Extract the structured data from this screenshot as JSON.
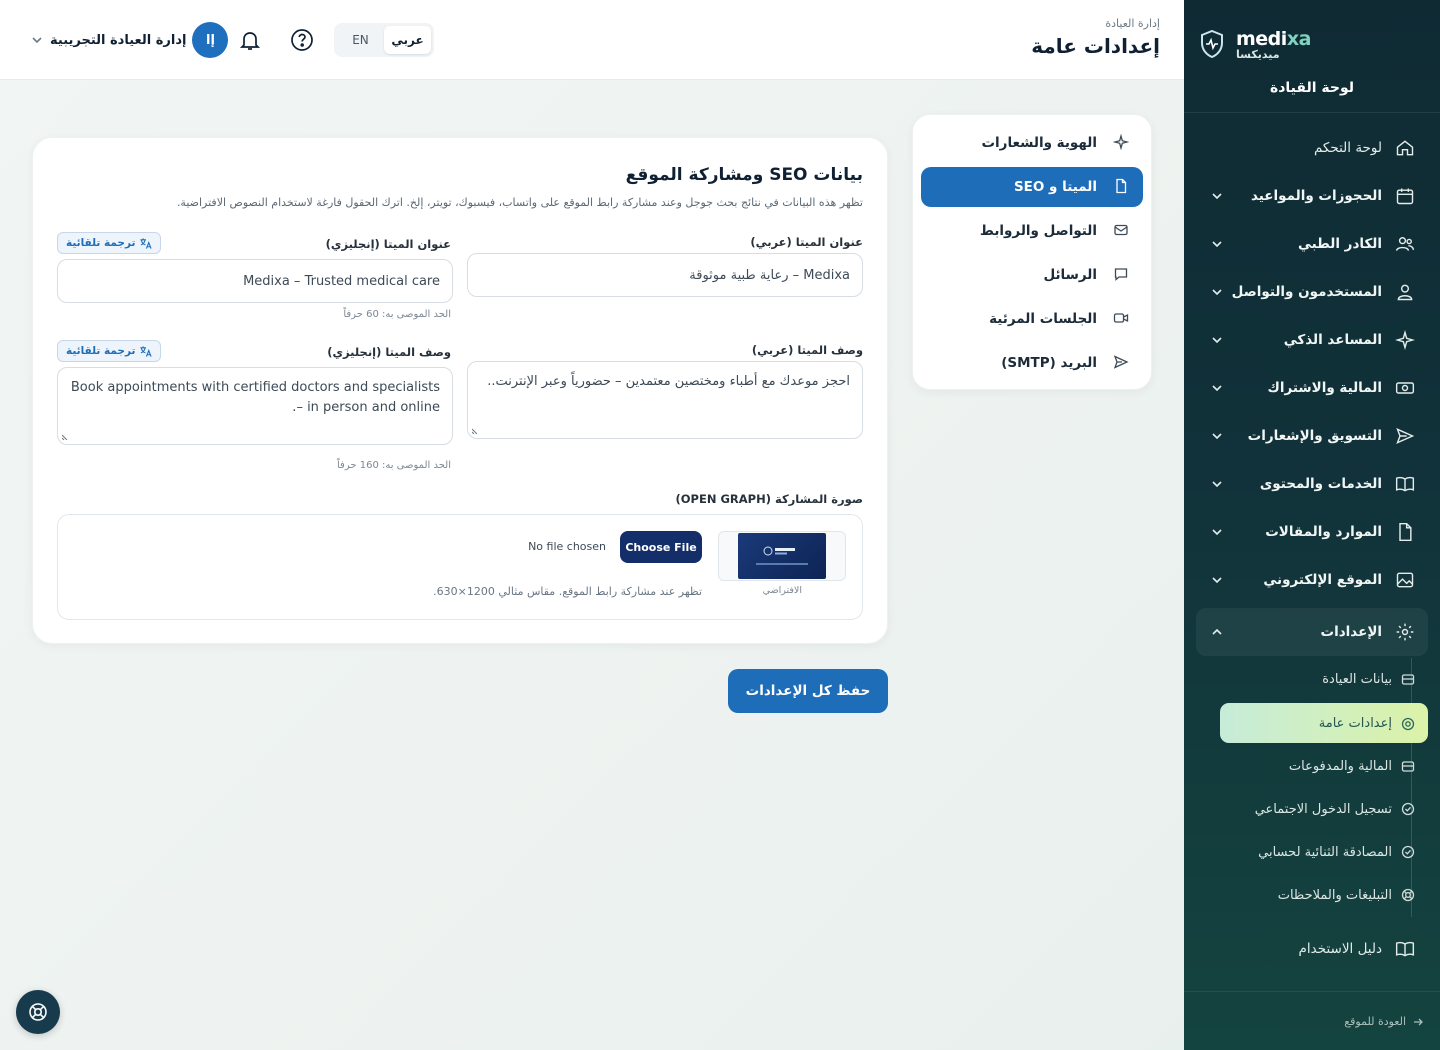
{
  "brand": {
    "name_a": "medi",
    "name_b": "xa",
    "name_ar": "ميديكسا",
    "dashboard_title": "لوحة القيادة"
  },
  "sidebar": {
    "items": [
      {
        "label": "لوحة التحكم",
        "icon": "home-icon"
      },
      {
        "label": "الحجوزات والمواعيد",
        "icon": "calendar-icon"
      },
      {
        "label": "الكادر الطبي",
        "icon": "users-icon"
      },
      {
        "label": "المستخدمون والتواصل",
        "icon": "user-icon"
      },
      {
        "label": "المساعد الذكي",
        "icon": "sparkles-icon"
      },
      {
        "label": "المالية والاشتراك",
        "icon": "money-icon"
      },
      {
        "label": "التسويق والإشعارات",
        "icon": "send-icon"
      },
      {
        "label": "الخدمات والمحتوى",
        "icon": "book-icon"
      },
      {
        "label": "الموارد والمقالات",
        "icon": "file-icon"
      },
      {
        "label": "الموقع الإلكتروني",
        "icon": "image-icon"
      }
    ],
    "settings_label": "الإعدادات",
    "sub_items": [
      {
        "label": "بيانات العيادة"
      },
      {
        "label": "إعدادات عامة"
      },
      {
        "label": "المالية والمدفوعات"
      },
      {
        "label": "تسجيل الدخول الاجتماعي"
      },
      {
        "label": "المصادقة الثنائية لحسابي"
      },
      {
        "label": "التبليغات والملاحظات"
      }
    ],
    "guide_label": "دليل الاستخدام",
    "back_label": "العودة للموقع"
  },
  "header": {
    "breadcrumb": "إدارة العيادة",
    "title": "إعدادات عامة",
    "lang_ar": "عربي",
    "lang_en": "EN",
    "user_name": "إدارة العيادة التجريبية",
    "user_initials": "إا"
  },
  "submenu": {
    "items": [
      {
        "label": "الهوية والشعارات"
      },
      {
        "label": "الميتا و SEO"
      },
      {
        "label": "التواصل والروابط"
      },
      {
        "label": "الرسائل"
      },
      {
        "label": "الجلسات المرئية"
      },
      {
        "label": "البريد (SMTP)"
      }
    ]
  },
  "seo": {
    "title": "بيانات SEO ومشاركة الموقع",
    "description": "تظهر هذه البيانات في نتائج بحث جوجل وعند مشاركة رابط الموقع على واتساب، فيسبوك، تويتر، إلخ. اترك الحقول فارغة لاستخدام النصوص الافتراضية.",
    "meta_title_ar_label": "عنوان الميتا (عربي)",
    "meta_title_ar_value": "Medixa – رعاية طبية موثوقة",
    "meta_title_en_label": "عنوان الميتا (إنجليزي)",
    "meta_title_en_value": "Medixa – Trusted medical care",
    "meta_title_hint": "الحد الموصى به: 60 حرفاً",
    "meta_desc_ar_label": "وصف الميتا (عربي)",
    "meta_desc_ar_value": "احجز موعدك مع أطباء ومختصين معتمدين – حضورياً وعبر الإنترنت..",
    "meta_desc_en_label": "وصف الميتا (إنجليزي)",
    "meta_desc_en_value": "Book appointments with certified doctors and specialists – in person and online.",
    "meta_desc_hint": "الحد الموصى به: 160 حرفاً",
    "auto_translate": "ترجمة تلقائية",
    "og_label": "صورة المشاركة (OPEN GRAPH)",
    "og_default_caption": "الافتراضي",
    "choose_file": "Choose File",
    "no_file": "No file chosen",
    "og_hint": "تظهر عند مشاركة رابط الموقع. مقاس مثالي 1200×630."
  },
  "save_label": "حفظ كل الإعدادات",
  "colors": {
    "primary": "#1e6db9",
    "sidebar": "#0f2a33",
    "active_sub": "#c6ecd9"
  }
}
